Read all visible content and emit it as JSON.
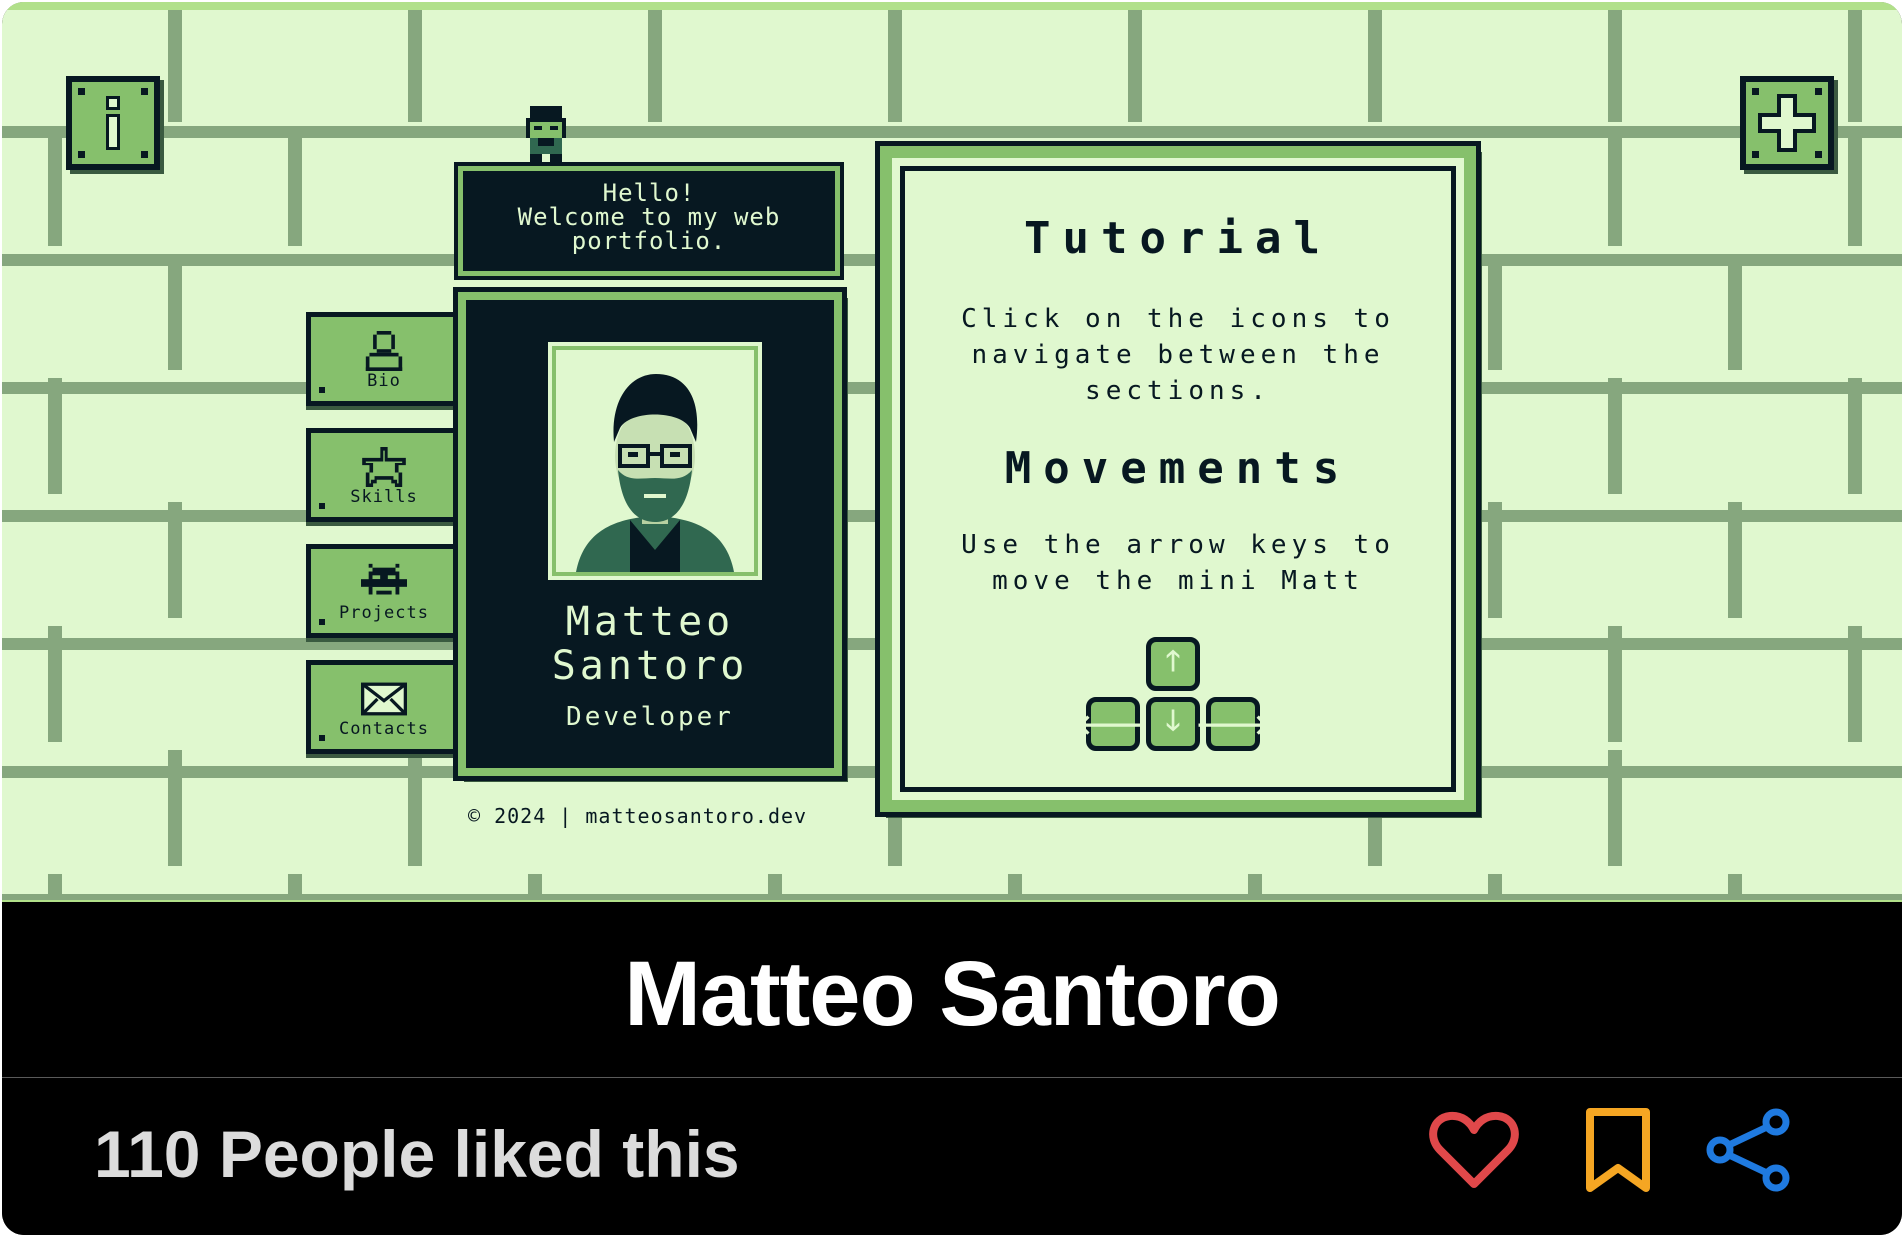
{
  "screen": {
    "speech": {
      "line1": "Hello!",
      "line2": "Welcome to my web",
      "line3": "portfolio."
    },
    "nav": [
      {
        "label": "Bio",
        "icon": "person-icon"
      },
      {
        "label": "Skills",
        "icon": "star-icon"
      },
      {
        "label": "Projects",
        "icon": "invader-icon"
      },
      {
        "label": "Contacts",
        "icon": "envelope-icon"
      }
    ],
    "profile": {
      "name_first": "Matteo",
      "name_last": "Santoro",
      "role": "Developer"
    },
    "footer_note": "© 2024 | matteosantoro.dev",
    "tutorial": {
      "heading": "Tutorial",
      "line1": "Click on the icons to",
      "line2": "navigate between the",
      "line3": "sections.",
      "movements_heading": "Movements",
      "mline1": "Use the arrow keys to",
      "mline2": "move the mini Matt"
    },
    "keys": {
      "up": "🡑",
      "left": "🡐",
      "down": "🡓",
      "right": "🡒"
    },
    "colors": {
      "darkest": "#071821",
      "dark": "#306850",
      "mid": "#86c06c",
      "light": "#e0f8cf"
    }
  },
  "card": {
    "title": "Matteo Santoro",
    "likes_text": "110 People liked this",
    "actions": [
      {
        "name": "like",
        "icon": "heart-icon",
        "color": "#e0484a"
      },
      {
        "name": "bookmark",
        "icon": "bookmark-icon",
        "color": "#f5a623"
      },
      {
        "name": "share",
        "icon": "share-icon",
        "color": "#1f7ae0"
      }
    ]
  }
}
